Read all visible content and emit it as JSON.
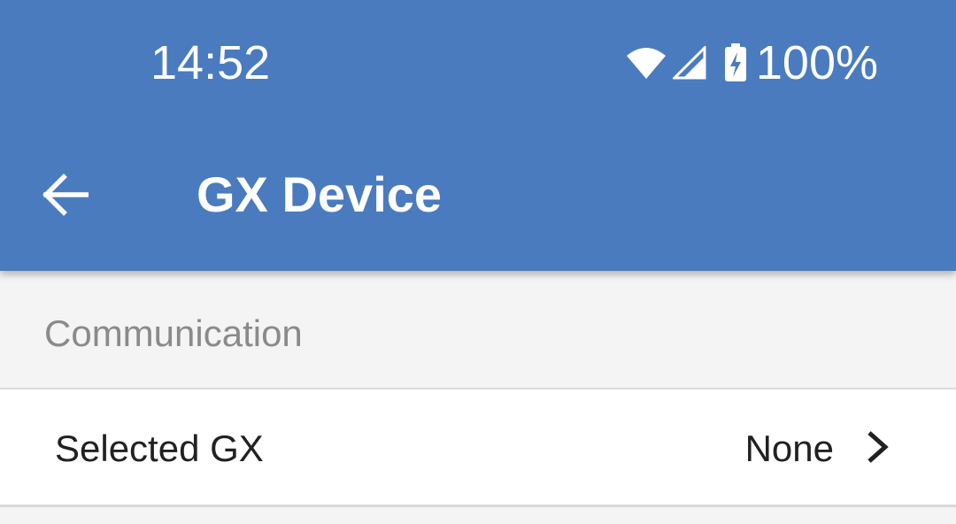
{
  "status_bar": {
    "time": "14:52",
    "battery_percent": "100%",
    "icons": [
      "wifi-icon",
      "cell-signal-icon",
      "battery-charging-icon"
    ]
  },
  "app_bar": {
    "back_icon": "arrow-back-icon",
    "title": "GX Device"
  },
  "section": {
    "title": "Communication"
  },
  "rows": [
    {
      "label": "Selected GX",
      "value": "None",
      "icon": "chevron-right-icon"
    }
  ],
  "colors": {
    "app_bar": "#4a7bbf",
    "background": "#f4f4f4",
    "row_background": "#ffffff",
    "section_text": "#8a8a8a",
    "primary_text": "#212121"
  }
}
